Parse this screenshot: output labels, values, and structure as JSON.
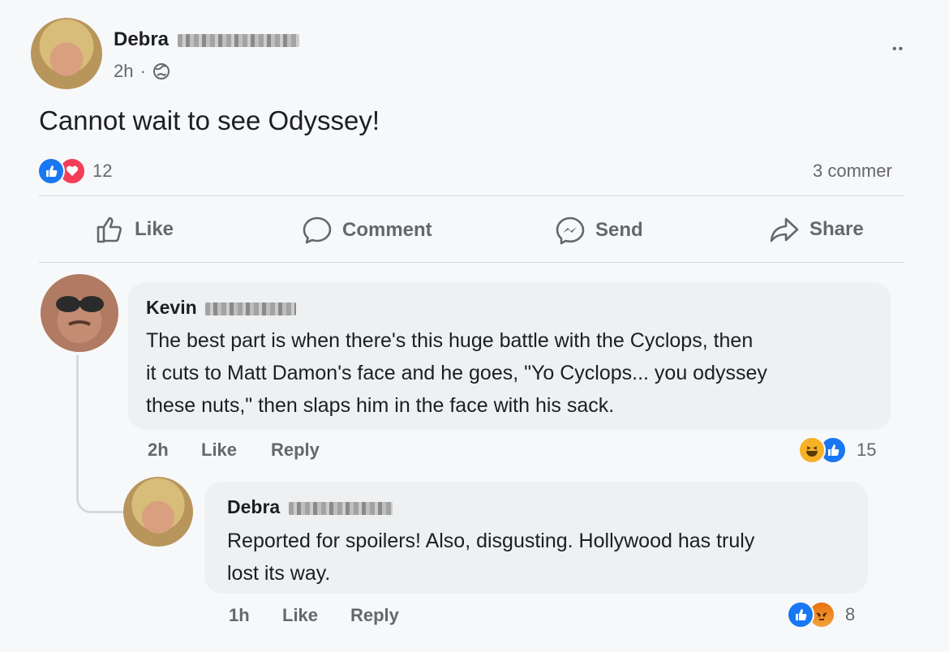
{
  "post": {
    "author": "Debra",
    "time": "2h",
    "dot": "·",
    "text": "Cannot wait to see Odyssey!",
    "reaction_count": "12",
    "comments_count": "3 commer",
    "more_glyph": "••"
  },
  "actions": {
    "like": "Like",
    "comment": "Comment",
    "send": "Send",
    "share": "Share"
  },
  "comments": [
    {
      "author": "Kevin",
      "text_lines": [
        "The best part is when there's this huge battle with the Cyclops, then",
        "it cuts to Matt Damon's face and he goes, \"Yo Cyclops... you odyssey",
        "these nuts,\" then slaps him in the face with his sack."
      ],
      "time": "2h",
      "like_label": "Like",
      "reply_label": "Reply",
      "reaction_count": "15",
      "reactions": [
        "haha-icon",
        "like-icon"
      ]
    },
    {
      "author": "Debra",
      "text_lines": [
        "Reported for spoilers! Also, disgusting. Hollywood has truly",
        "lost its way."
      ],
      "time": "1h",
      "like_label": "Like",
      "reply_label": "Reply",
      "reaction_count": "8",
      "reactions": [
        "like-icon",
        "angry-icon"
      ]
    }
  ],
  "colors": {
    "like_blue": "#1877f2",
    "love_red": "#f33e58",
    "angry_orange": "#e9710f",
    "haha_yellow": "#f7b125"
  }
}
